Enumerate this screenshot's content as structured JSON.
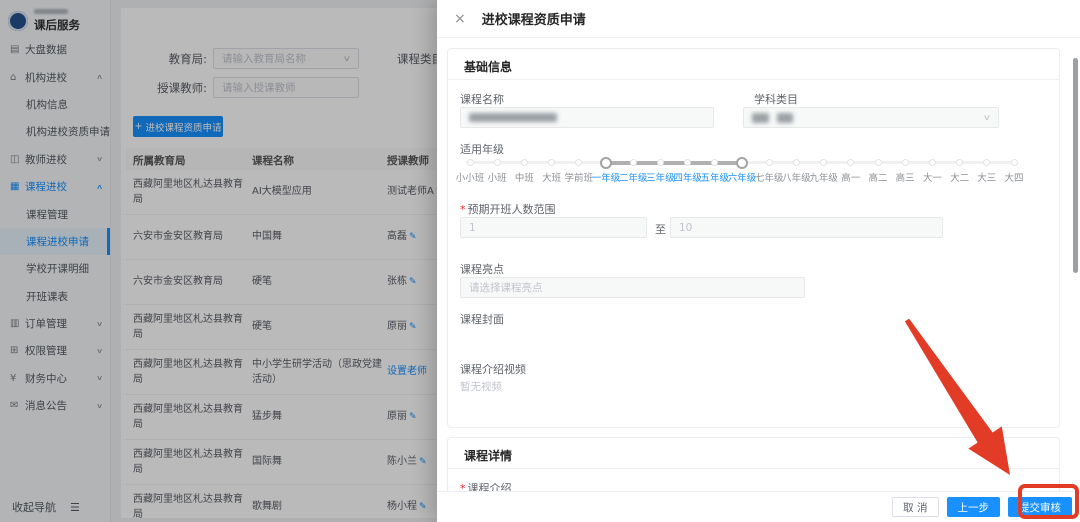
{
  "colors": {
    "primary": "#1890ff",
    "annotation_red": "#e23b26",
    "required_red": "#f5222d"
  },
  "icons": {
    "edit": "✎",
    "close": "×",
    "chevron_down": "∨",
    "chevron_up": "∧",
    "plus": "+",
    "collapse": "☰"
  },
  "sidebar": {
    "logo_title": "课后服务",
    "collapse_label": "收起导航",
    "items": [
      {
        "label": "大盘数据",
        "type": "top",
        "icon": "dashboard-icon",
        "glyph": "▤"
      },
      {
        "label": "机构进校",
        "type": "top",
        "icon": "organization-icon",
        "glyph": "⌂",
        "arrow": "up"
      },
      {
        "label": "机构信息",
        "type": "sub"
      },
      {
        "label": "机构进校资质申请",
        "type": "sub"
      },
      {
        "label": "教师进校",
        "type": "top",
        "icon": "teacher-icon",
        "glyph": "◫",
        "arrow": "down"
      },
      {
        "label": "课程进校",
        "type": "top",
        "icon": "course-icon",
        "glyph": "▦",
        "arrow": "up",
        "active": true
      },
      {
        "label": "课程管理",
        "type": "sub"
      },
      {
        "label": "课程进校申请",
        "type": "sub",
        "selected": true
      },
      {
        "label": "学校开课明细",
        "type": "sub"
      },
      {
        "label": "开班课表",
        "type": "sub"
      },
      {
        "label": "订单管理",
        "type": "top",
        "icon": "order-icon",
        "glyph": "▥",
        "arrow": "down"
      },
      {
        "label": "权限管理",
        "type": "top",
        "icon": "permission-icon",
        "glyph": "⊞",
        "arrow": "down"
      },
      {
        "label": "财务中心",
        "type": "top",
        "icon": "finance-icon",
        "glyph": "¥",
        "arrow": "down"
      },
      {
        "label": "消息公告",
        "type": "top",
        "icon": "message-icon",
        "glyph": "✉",
        "arrow": "down"
      }
    ]
  },
  "main": {
    "filters": {
      "bureau_label": "教育局:",
      "bureau_placeholder": "请输入教育局名称",
      "teacher_label": "授课教师:",
      "teacher_placeholder": "请输入授课教师",
      "category_label": "课程类目"
    },
    "add_button_label": "进校课程资质申请",
    "table": {
      "headers": [
        "所属教育局",
        "课程名称",
        "授课教师"
      ],
      "rows": [
        {
          "bureau": "西藏阿里地区札达县教育局",
          "course": "AI大模型应用",
          "teacher": "测试老师A",
          "teacher_type": "edit"
        },
        {
          "bureau": "六安市金安区教育局",
          "course": "中国舞",
          "teacher": "高磊",
          "teacher_type": "edit"
        },
        {
          "bureau": "六安市金安区教育局",
          "course": "硬笔",
          "teacher": "张栋",
          "teacher_type": "edit"
        },
        {
          "bureau": "西藏阿里地区札达县教育局",
          "course": "硬笔",
          "teacher": "原丽",
          "teacher_type": "edit"
        },
        {
          "bureau": "西藏阿里地区札达县教育局",
          "course": "中小学生研学活动（思政党建活动）",
          "teacher": "设置老师",
          "teacher_type": "link"
        },
        {
          "bureau": "西藏阿里地区札达县教育局",
          "course": "猛步舞",
          "teacher": "原丽",
          "teacher_type": "edit"
        },
        {
          "bureau": "西藏阿里地区札达县教育局",
          "course": "国际舞",
          "teacher": "陈小兰",
          "teacher_type": "edit"
        },
        {
          "bureau": "西藏阿里地区札达县教育局",
          "course": "歌舞剧",
          "teacher": "杨小程",
          "teacher_type": "edit"
        }
      ]
    }
  },
  "drawer": {
    "title": "进校课程资质申请",
    "sections": {
      "basic": "基础信息",
      "detail": "课程详情"
    },
    "fields": {
      "course_name_label": "课程名称",
      "subject_label": "学科类目",
      "grade_label": "适用年级",
      "class_size_label": "预期开班人数范围",
      "class_size_min": "1",
      "class_size_to": "至",
      "class_size_max": "10",
      "highlight_label": "课程亮点",
      "highlight_placeholder": "请选择课程亮点",
      "cover_label": "课程封面",
      "video_label": "课程介绍视频",
      "video_empty": "暂无视频",
      "intro_label": "课程介绍"
    },
    "grades": {
      "marks": [
        "小小班",
        "小班",
        "中班",
        "大班",
        "学前班",
        "一年级",
        "二年级",
        "三年级",
        "四年级",
        "五年级",
        "六年级",
        "七年级",
        "八年级",
        "九年级",
        "高一",
        "高二",
        "高三",
        "大一",
        "大二",
        "大三",
        "大四"
      ],
      "selected_from": "一年级",
      "selected_to": "六年级",
      "selected_range": [
        5,
        10
      ]
    },
    "footer": {
      "cancel": "取 消",
      "prev": "上一步",
      "submit": "提交审核"
    }
  },
  "annotation": {
    "type": "arrow-and-box-highlight",
    "target": "submit-button",
    "color": "#e23b26"
  }
}
